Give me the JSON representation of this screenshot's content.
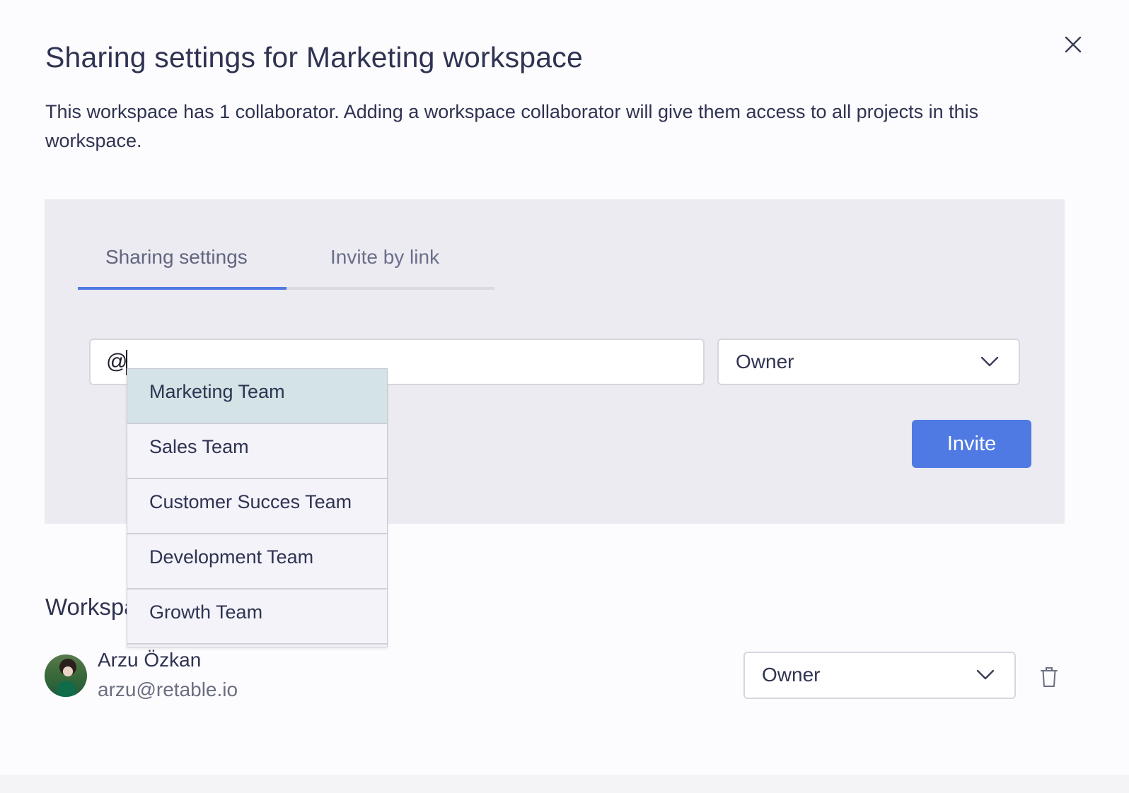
{
  "dialog": {
    "title": "Sharing settings for Marketing workspace",
    "description": "This workspace has 1 collaborator. Adding a workspace collaborator will give them access to all projects in this workspace."
  },
  "tabs": [
    {
      "label": "Sharing settings",
      "active": true
    },
    {
      "label": "Invite by link",
      "active": false
    }
  ],
  "invite_form": {
    "input_value": "@",
    "role": "Owner",
    "invite_label": "Invite"
  },
  "mention_dropdown": {
    "items": [
      "Marketing Team",
      "Sales Team",
      "Customer Succes Team",
      "Development Team",
      "Growth Team"
    ],
    "highlighted_index": 0
  },
  "collaborators": {
    "heading": "Workspace collaborators",
    "list": [
      {
        "name": "Arzu Özkan",
        "email": "arzu@retable.io",
        "role": "Owner"
      }
    ]
  },
  "colors": {
    "accent": "#4f7ae3",
    "panel_bg": "#ebebf1",
    "highlight": "#d3e3e6"
  }
}
